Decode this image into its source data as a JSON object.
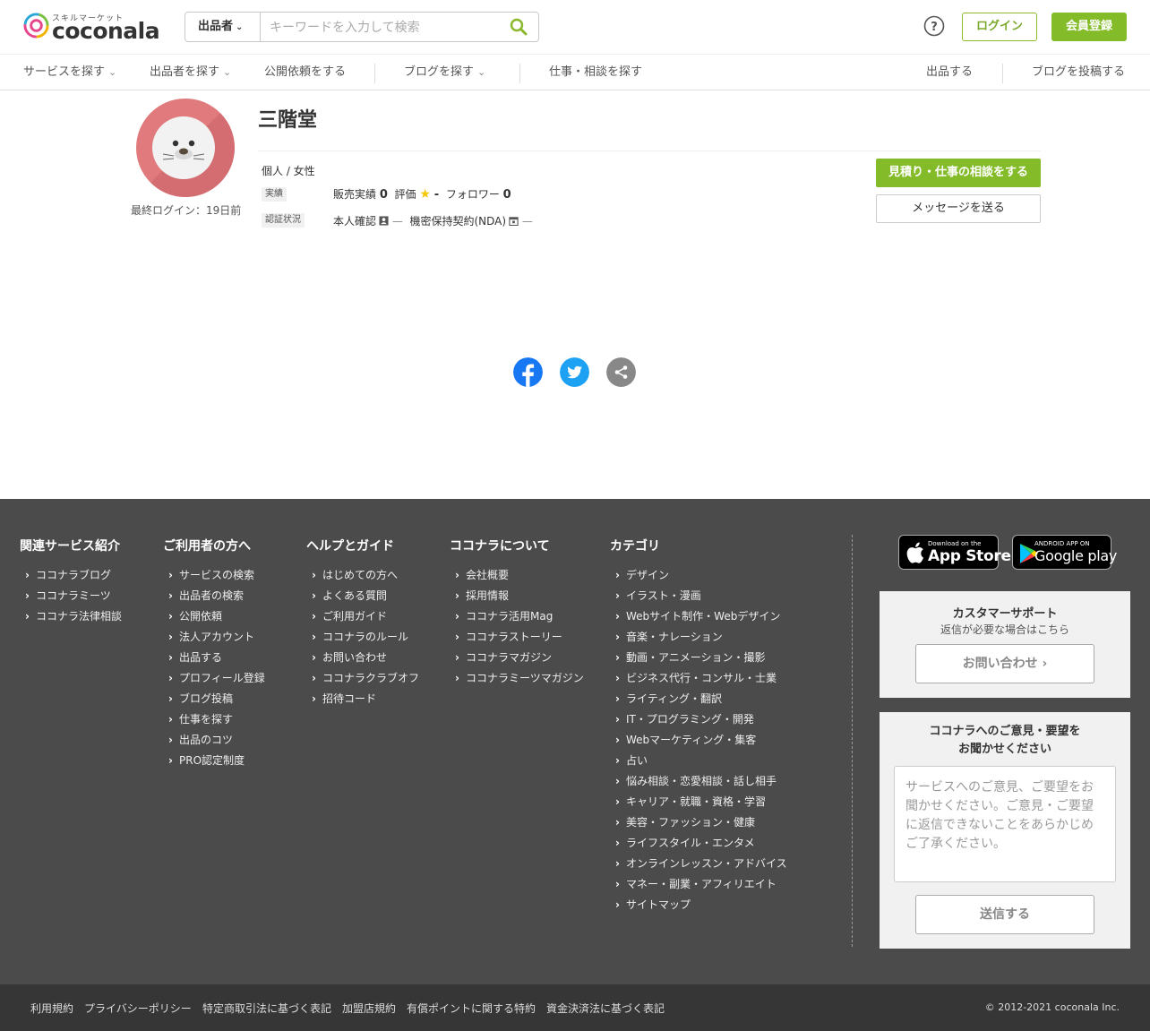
{
  "header": {
    "logo_sub": "スキルマーケット",
    "logo_word": "coconala",
    "search_scope": "出品者",
    "search_placeholder": "キーワードを入力して検索",
    "login": "ログイン",
    "register": "会員登録"
  },
  "nav": {
    "items": [
      {
        "label": "サービスを探す",
        "dropdown": true
      },
      {
        "label": "出品者を探す",
        "dropdown": true
      },
      {
        "label": "公開依頼をする",
        "dropdown": false
      },
      {
        "label": "ブログを探す",
        "dropdown": true
      },
      {
        "label": "仕事・相談を探す",
        "dropdown": false
      }
    ],
    "right": [
      "出品する",
      "ブログを投稿する"
    ]
  },
  "profile": {
    "name": "三階堂",
    "last_login": "最終ログイン：19日前",
    "type": "個人 / 女性",
    "record_chip": "実績",
    "sales_label": "販売実績",
    "sales_value": "0",
    "rating_label": "評価",
    "rating_value": "-",
    "follower_label": "フォロワー",
    "follower_value": "0",
    "cert_chip": "認証状況",
    "identity_label": "本人確認",
    "identity_status": "—",
    "nda_label": "機密保持契約(NDA)",
    "nda_status": "—",
    "consult_button": "見積り・仕事の相談をする",
    "message_button": "メッセージを送る"
  },
  "footer": {
    "columns": [
      {
        "title": "関連サービス紹介",
        "links": [
          "ココナラブログ",
          "ココナラミーツ",
          "ココナラ法律相談"
        ]
      },
      {
        "title": "ご利用者の方へ",
        "links": [
          "サービスの検索",
          "出品者の検索",
          "公開依頼",
          "法人アカウント",
          "出品する",
          "プロフィール登録",
          "ブログ投稿",
          "仕事を探す",
          "出品のコツ",
          "PRO認定制度"
        ]
      },
      {
        "title": "ヘルプとガイド",
        "links": [
          "はじめての方へ",
          "よくある質問",
          "ご利用ガイド",
          "ココナラのルール",
          "お問い合わせ",
          "ココナラクラブオフ",
          "招待コード"
        ]
      },
      {
        "title": "ココナラについて",
        "links": [
          "会社概要",
          "採用情報",
          "ココナラ活用Mag",
          "ココナラストーリー",
          "ココナラマガジン",
          "ココナラミーツマガジン"
        ]
      },
      {
        "title": "カテゴリ",
        "links": [
          "デザイン",
          "イラスト・漫画",
          "Webサイト制作・Webデザイン",
          "音楽・ナレーション",
          "動画・アニメーション・撮影",
          "ビジネス代行・コンサル・士業",
          "ライティング・翻訳",
          "IT・プログラミング・開発",
          "Webマーケティング・集客",
          "占い",
          "悩み相談・恋愛相談・話し相手",
          "キャリア・就職・資格・学習",
          "美容・ファッション・健康",
          "ライフスタイル・エンタメ",
          "オンラインレッスン・アドバイス",
          "マネー・副業・アフィリエイト",
          "サイトマップ"
        ]
      }
    ],
    "appstore_small": "Download on the",
    "appstore_big": "App Store",
    "googleplay_small": "ANDROID APP ON",
    "googleplay_big": "Google play",
    "support_title": "カスタマーサポート",
    "support_sub": "返信が必要な場合はこちら",
    "support_button": "お問い合わせ",
    "feedback_title_1": "ココナラへのご意見・要望を",
    "feedback_title_2": "お聞かせください",
    "feedback_placeholder": "サービスへのご意見、ご要望をお聞かせください。ご意見・ご要望に返信できないことをあらかじめご了承ください。",
    "feedback_button": "送信する",
    "bottom_links": [
      "利用規約",
      "プライバシーポリシー",
      "特定商取引法に基づく表記",
      "加盟店規約",
      "有償ポイントに関する特約",
      "資金決済法に基づく表記"
    ],
    "copyright": "© 2012-2021 coconala Inc."
  },
  "colors": {
    "brand_green": "#84bc29",
    "footer_bg": "#4b4b4b",
    "bottom_bg": "#363636",
    "avatar_bg": "#e07a7d",
    "facebook": "#1877f2",
    "twitter": "#1da1f2",
    "share": "#888888"
  },
  "icons": [
    "help-icon",
    "search-icon",
    "chevron-down-icon",
    "star-icon",
    "id-card-icon",
    "lock-icon",
    "facebook-icon",
    "twitter-icon",
    "share-icon",
    "apple-icon",
    "google-play-icon",
    "chevron-right-icon"
  ]
}
